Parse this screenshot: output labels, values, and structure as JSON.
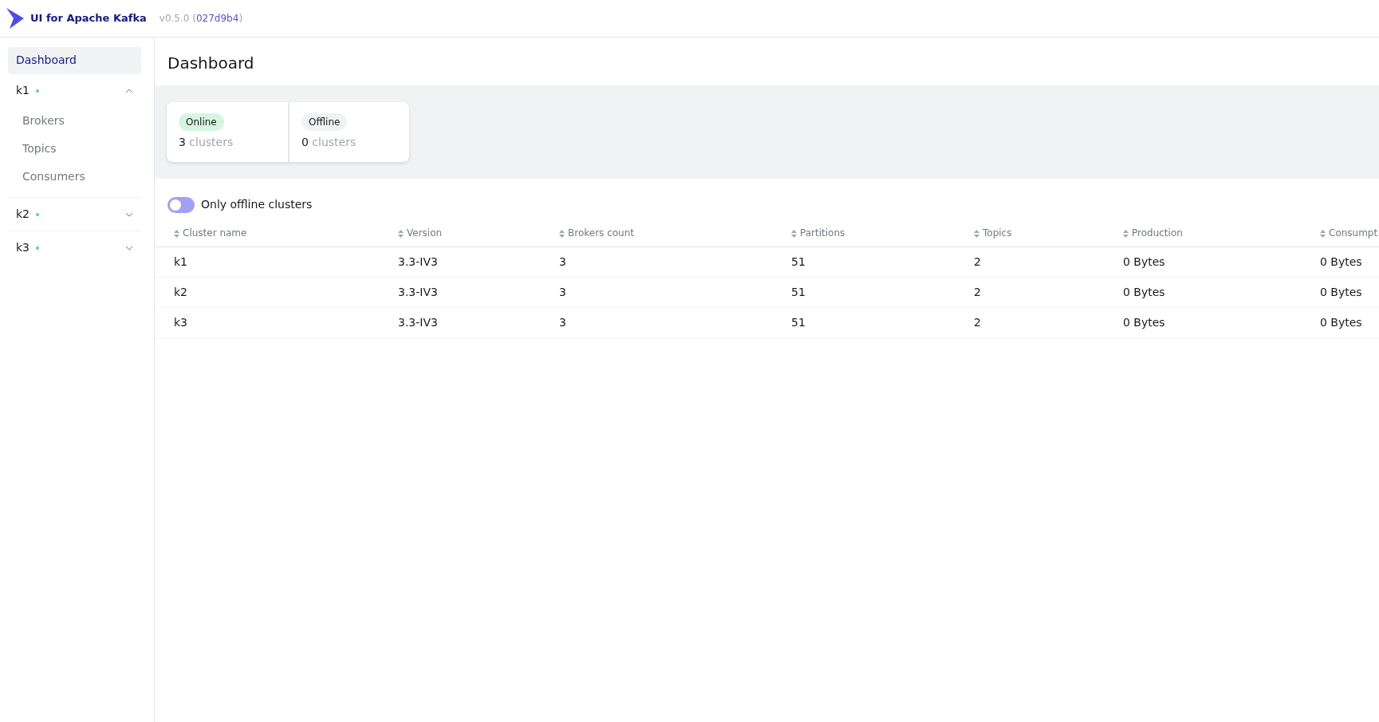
{
  "header": {
    "title": "UI for Apache Kafka",
    "version": "v0.5.0",
    "commit_open": "(",
    "commit": "027d9b4",
    "commit_close": ")"
  },
  "sidebar": {
    "items": [
      {
        "kind": "link",
        "label": "Dashboard",
        "selected": true
      },
      {
        "kind": "cluster",
        "label": "k1",
        "color": "#5cd685",
        "expanded": true,
        "children": [
          {
            "label": "Brokers",
            "selected": false
          },
          {
            "label": "Topics",
            "selected": false
          },
          {
            "label": "Consumers",
            "selected": false
          }
        ]
      },
      {
        "kind": "cluster",
        "label": "k2",
        "color": "#5cd685",
        "expanded": false
      },
      {
        "kind": "cluster",
        "label": "k3",
        "color": "#5cd685",
        "expanded": false
      }
    ]
  },
  "page_title": "Dashboard",
  "stats": [
    {
      "tag": "Online",
      "color": "#d6f5e0",
      "count": "3",
      "unit": "clusters"
    },
    {
      "tag": "Offline",
      "color": "#f1f2f3",
      "count": "0",
      "unit": "clusters"
    }
  ],
  "filter": {
    "label": "Only offline clusters",
    "on": false
  },
  "table": {
    "columns": [
      "Cluster name",
      "Version",
      "Brokers count",
      "Partitions",
      "Topics",
      "Production",
      "Consumpt"
    ],
    "rows": [
      [
        "k1",
        "3.3-IV3",
        "3",
        "51",
        "2",
        "0 Bytes",
        "0 Bytes"
      ],
      [
        "k2",
        "3.3-IV3",
        "3",
        "51",
        "2",
        "0 Bytes",
        "0 Bytes"
      ],
      [
        "k3",
        "3.3-IV3",
        "3",
        "51",
        "2",
        "0 Bytes",
        "0 Bytes"
      ]
    ]
  }
}
